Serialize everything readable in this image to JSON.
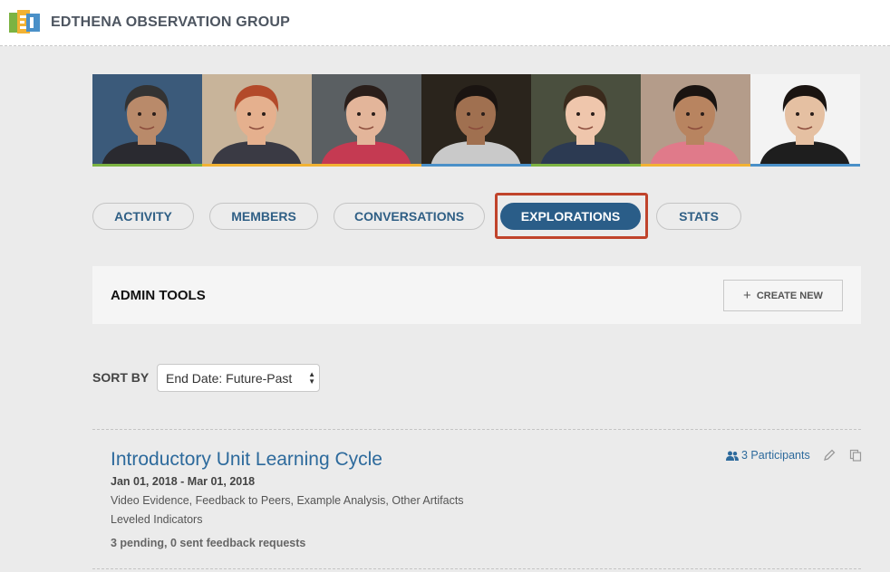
{
  "header": {
    "group_name": "EDTHENA OBSERVATION GROUP",
    "logo_icon": "edthena-logo-icon"
  },
  "banner": {
    "members": [
      {
        "name": "member-photo-1",
        "bg": "#3b5a7a",
        "skin": "#b98a6a",
        "hair": "#333333",
        "shirt": "#2a2a30",
        "stripe": "#7cb342"
      },
      {
        "name": "member-photo-2",
        "bg": "#c8b49a",
        "skin": "#e5b08e",
        "hair": "#b34a2a",
        "shirt": "#3a3a44",
        "stripe": "#f2b233"
      },
      {
        "name": "member-photo-3",
        "bg": "#5a5f62",
        "skin": "#e3b59a",
        "hair": "#2a1e1a",
        "shirt": "#c53a52",
        "stripe": "#f2b233"
      },
      {
        "name": "member-photo-4",
        "bg": "#2a241c",
        "skin": "#a07050",
        "hair": "#1a1411",
        "shirt": "#c9c9c9",
        "stripe": "#4a90c8"
      },
      {
        "name": "member-photo-5",
        "bg": "#4a4f3e",
        "skin": "#efc6ac",
        "hair": "#3a2a1c",
        "shirt": "#2c3a52",
        "stripe": "#7cb342"
      },
      {
        "name": "member-photo-6",
        "bg": "#b49c8a",
        "skin": "#b88460",
        "hair": "#1a1411",
        "shirt": "#e07a8a",
        "stripe": "#f2b233"
      },
      {
        "name": "member-photo-7",
        "bg": "#f3f3f3",
        "skin": "#e5c0a2",
        "hair": "#1a1411",
        "shirt": "#1e1e1e",
        "stripe": "#4a90c8"
      }
    ]
  },
  "tabs": [
    {
      "label": "ACTIVITY",
      "active": false
    },
    {
      "label": "MEMBERS",
      "active": false
    },
    {
      "label": "CONVERSATIONS",
      "active": false
    },
    {
      "label": "EXPLORATIONS",
      "active": true
    },
    {
      "label": "STATS",
      "active": false
    }
  ],
  "admin": {
    "title": "ADMIN TOOLS",
    "create_label": "CREATE NEW"
  },
  "sort": {
    "label": "SORT BY",
    "selected": "End Date: Future-Past"
  },
  "exploration": {
    "title": "Introductory Unit Learning Cycle",
    "dates": "Jan 01, 2018 - Mar 01, 2018",
    "types": "Video Evidence, Feedback to Peers, Example Analysis, Other Artifacts",
    "indicators": "Leveled Indicators",
    "pending": "3 pending, 0 sent feedback requests",
    "participants": "3 Participants"
  },
  "colors": {
    "accent": "#2a5d88",
    "link": "#2d6a9c",
    "highlight": "#c0432b"
  }
}
